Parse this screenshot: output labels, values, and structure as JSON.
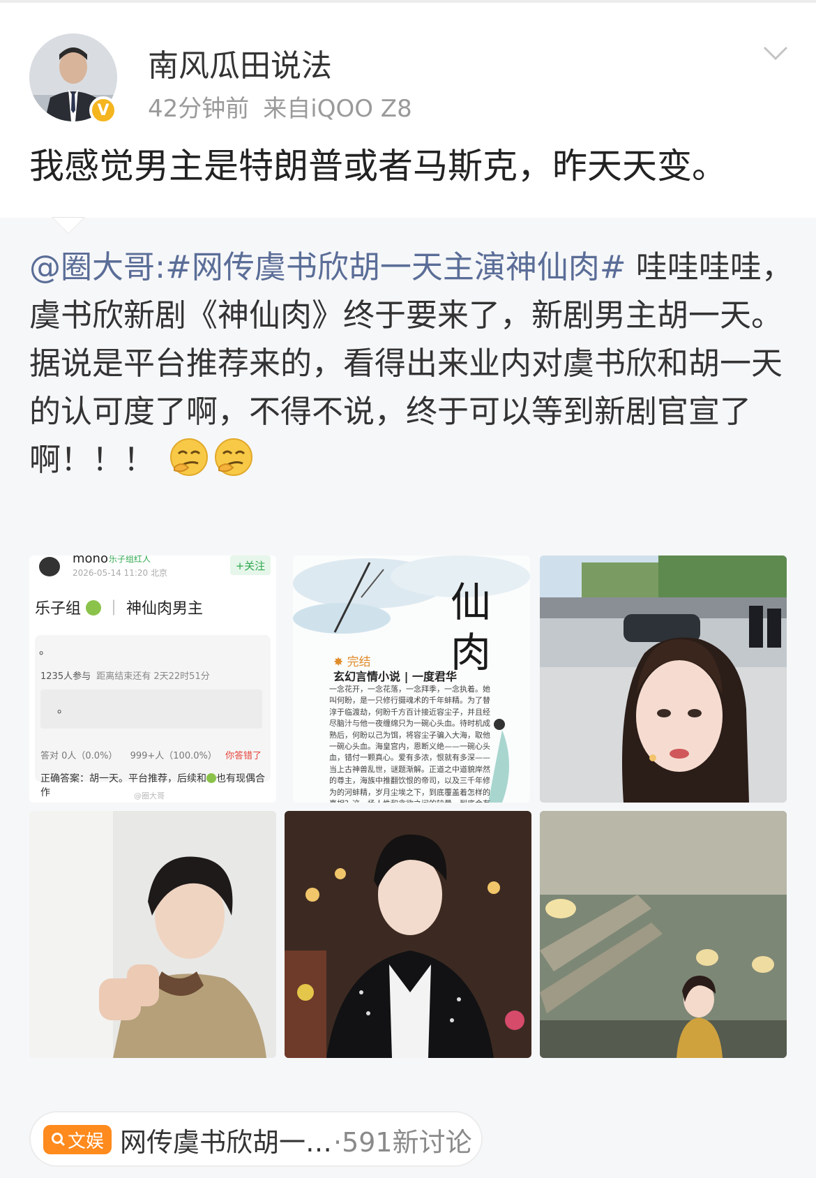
{
  "post": {
    "username": "南风瓜田说法",
    "time": "42分钟前",
    "source": "来自iQOO Z8",
    "text": "我感觉男主是特朗普或者马斯克，昨天天变。"
  },
  "repost": {
    "mention": "@圈大哥",
    "hashtag": ":#网传虞书欣胡一天主演神仙肉#",
    "text": " 哇哇哇哇，虞书欣新剧《神仙肉》终于要来了，新剧男主胡一天。\n据说是平台推荐来的，看得出来业内对虞书欣和胡一天的认可度了啊，不得不说，终于可以等到新剧官宣了啊！！！",
    "emoji_names": [
      "smirk-emoji",
      "smirk-emoji"
    ],
    "images": {
      "poll": {
        "user": "mono",
        "tag": "乐子组红人",
        "follow": "+关注",
        "date": "2026-05-14 11:20 北京",
        "title_group": "乐子组",
        "title_topic": "神仙肉男主",
        "dot": "。",
        "participants": "1235人参与",
        "remaining": "距离结束还有 2天22时51分",
        "option": "。",
        "stat_correct": "答对 0人（0.0%）",
        "stat_wrong": "999+人（100.0%）",
        "result": "你答错了",
        "answer": "正确答案：胡一天。平台推荐，后续和",
        "answer_tail": "也有现偶合作",
        "watermark": "@圈大哥"
      },
      "novel": {
        "title_char1": "仙",
        "title_char2": "肉",
        "status": "完结",
        "genre": "玄幻言情小说 | 一度君华",
        "blurb": "一念花开，一念花落，一念拜季，一念执着。她叫何盼，是一只修行摄魂术的千年蚌精。为了替淳于临渡劫，何盼千方百计接近容尘子，并且经尽脑汁与他一夜缠绵只为一碗心头血。待时机成熟后，何盼以己为饵，将容尘子骗入大海，取他一碗心头血。海皇宫内，恩断义绝——一碗心头血，错付一颗真心。爱有多浓，恨就有多深——当上古神兽乱世，谜题渐解。正道之中道貌岸然的尊主，海族中推翻饮恨的帝司，以及三千年修为的河蚌精，岁月尘埃之下，到底覆盖着怎样的真相？这一场人性和贪欲之间的较量，到底会有怎样的结局？"
      }
    }
  },
  "topic": {
    "tag": "文娱",
    "search_icon": "search-icon",
    "text": "网传虞书欣胡一…",
    "count": "·591新讨论"
  },
  "colors": {
    "mention": "#5a6d97",
    "tag_orange": "#ff8a1d",
    "verified": "#f5b51f",
    "follow_green": "#2fa84f",
    "wrong_red": "#e6453c"
  }
}
